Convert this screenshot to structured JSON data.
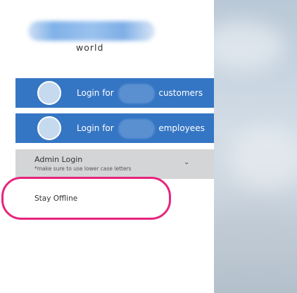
{
  "brand": {
    "logo_subtitle": "world"
  },
  "buttons": {
    "customers": {
      "prefix": "Login for",
      "suffix": "customers"
    },
    "employees": {
      "prefix": "Login for",
      "suffix": "employees"
    }
  },
  "admin": {
    "title": "Admin Login",
    "note": "*make sure to use lower case letters",
    "chevron": "⌄"
  },
  "offline": {
    "label": "Stay Offline"
  },
  "colors": {
    "primary_button": "#3576c4",
    "admin_background": "#d4d5d7",
    "highlight": "#e6257d"
  }
}
